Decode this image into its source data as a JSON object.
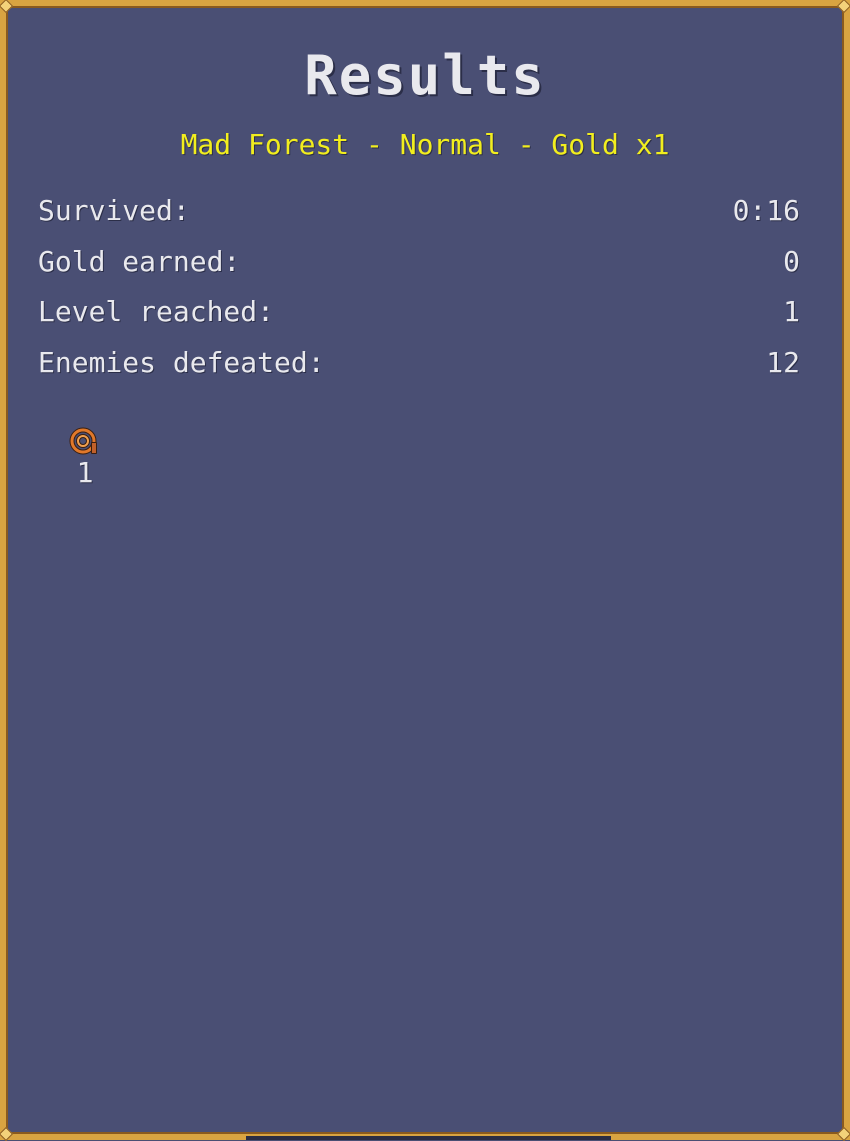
{
  "results": {
    "title": "Results",
    "subtitle": "Mad Forest - Normal - Gold x1"
  },
  "stats": [
    {
      "label": "Survived:",
      "value": "0:16"
    },
    {
      "label": "Gold earned:",
      "value": "0"
    },
    {
      "label": "Level reached:",
      "value": "1"
    },
    {
      "label": "Enemies defeated:",
      "value": "12"
    }
  ],
  "weapons": [
    {
      "icon": "whip-icon",
      "level": "1"
    }
  ],
  "colors": {
    "background": "#4a4f74",
    "border": "#d9a441",
    "title": "#e9e9ee",
    "subtitle": "#f2ee1e",
    "whip": "#e0782a"
  }
}
